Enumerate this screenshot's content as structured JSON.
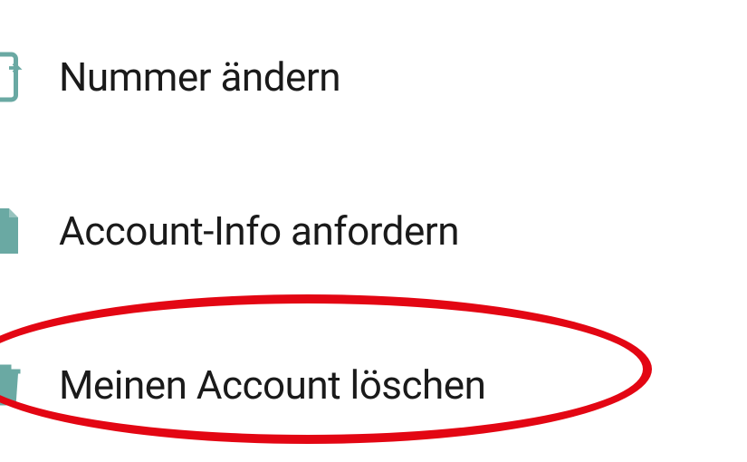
{
  "menu": {
    "items": [
      {
        "label": "Nummer ändern",
        "icon": "change-number-icon"
      },
      {
        "label": "Account-Info anfordern",
        "icon": "document-icon"
      },
      {
        "label": "Meinen Account löschen",
        "icon": "delete-icon"
      }
    ]
  },
  "colors": {
    "icon": "#6aa9a3",
    "highlight": "#e30613"
  }
}
